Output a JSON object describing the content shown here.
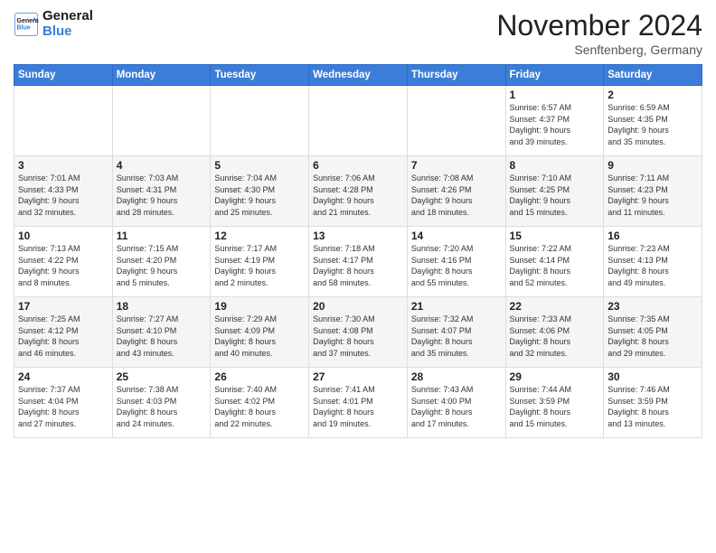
{
  "logo": {
    "line1": "General",
    "line2": "Blue"
  },
  "header": {
    "month": "November 2024",
    "location": "Senftenberg, Germany"
  },
  "weekdays": [
    "Sunday",
    "Monday",
    "Tuesday",
    "Wednesday",
    "Thursday",
    "Friday",
    "Saturday"
  ],
  "weeks": [
    [
      {
        "day": "",
        "info": ""
      },
      {
        "day": "",
        "info": ""
      },
      {
        "day": "",
        "info": ""
      },
      {
        "day": "",
        "info": ""
      },
      {
        "day": "",
        "info": ""
      },
      {
        "day": "1",
        "info": "Sunrise: 6:57 AM\nSunset: 4:37 PM\nDaylight: 9 hours\nand 39 minutes."
      },
      {
        "day": "2",
        "info": "Sunrise: 6:59 AM\nSunset: 4:35 PM\nDaylight: 9 hours\nand 35 minutes."
      }
    ],
    [
      {
        "day": "3",
        "info": "Sunrise: 7:01 AM\nSunset: 4:33 PM\nDaylight: 9 hours\nand 32 minutes."
      },
      {
        "day": "4",
        "info": "Sunrise: 7:03 AM\nSunset: 4:31 PM\nDaylight: 9 hours\nand 28 minutes."
      },
      {
        "day": "5",
        "info": "Sunrise: 7:04 AM\nSunset: 4:30 PM\nDaylight: 9 hours\nand 25 minutes."
      },
      {
        "day": "6",
        "info": "Sunrise: 7:06 AM\nSunset: 4:28 PM\nDaylight: 9 hours\nand 21 minutes."
      },
      {
        "day": "7",
        "info": "Sunrise: 7:08 AM\nSunset: 4:26 PM\nDaylight: 9 hours\nand 18 minutes."
      },
      {
        "day": "8",
        "info": "Sunrise: 7:10 AM\nSunset: 4:25 PM\nDaylight: 9 hours\nand 15 minutes."
      },
      {
        "day": "9",
        "info": "Sunrise: 7:11 AM\nSunset: 4:23 PM\nDaylight: 9 hours\nand 11 minutes."
      }
    ],
    [
      {
        "day": "10",
        "info": "Sunrise: 7:13 AM\nSunset: 4:22 PM\nDaylight: 9 hours\nand 8 minutes."
      },
      {
        "day": "11",
        "info": "Sunrise: 7:15 AM\nSunset: 4:20 PM\nDaylight: 9 hours\nand 5 minutes."
      },
      {
        "day": "12",
        "info": "Sunrise: 7:17 AM\nSunset: 4:19 PM\nDaylight: 9 hours\nand 2 minutes."
      },
      {
        "day": "13",
        "info": "Sunrise: 7:18 AM\nSunset: 4:17 PM\nDaylight: 8 hours\nand 58 minutes."
      },
      {
        "day": "14",
        "info": "Sunrise: 7:20 AM\nSunset: 4:16 PM\nDaylight: 8 hours\nand 55 minutes."
      },
      {
        "day": "15",
        "info": "Sunrise: 7:22 AM\nSunset: 4:14 PM\nDaylight: 8 hours\nand 52 minutes."
      },
      {
        "day": "16",
        "info": "Sunrise: 7:23 AM\nSunset: 4:13 PM\nDaylight: 8 hours\nand 49 minutes."
      }
    ],
    [
      {
        "day": "17",
        "info": "Sunrise: 7:25 AM\nSunset: 4:12 PM\nDaylight: 8 hours\nand 46 minutes."
      },
      {
        "day": "18",
        "info": "Sunrise: 7:27 AM\nSunset: 4:10 PM\nDaylight: 8 hours\nand 43 minutes."
      },
      {
        "day": "19",
        "info": "Sunrise: 7:29 AM\nSunset: 4:09 PM\nDaylight: 8 hours\nand 40 minutes."
      },
      {
        "day": "20",
        "info": "Sunrise: 7:30 AM\nSunset: 4:08 PM\nDaylight: 8 hours\nand 37 minutes."
      },
      {
        "day": "21",
        "info": "Sunrise: 7:32 AM\nSunset: 4:07 PM\nDaylight: 8 hours\nand 35 minutes."
      },
      {
        "day": "22",
        "info": "Sunrise: 7:33 AM\nSunset: 4:06 PM\nDaylight: 8 hours\nand 32 minutes."
      },
      {
        "day": "23",
        "info": "Sunrise: 7:35 AM\nSunset: 4:05 PM\nDaylight: 8 hours\nand 29 minutes."
      }
    ],
    [
      {
        "day": "24",
        "info": "Sunrise: 7:37 AM\nSunset: 4:04 PM\nDaylight: 8 hours\nand 27 minutes."
      },
      {
        "day": "25",
        "info": "Sunrise: 7:38 AM\nSunset: 4:03 PM\nDaylight: 8 hours\nand 24 minutes."
      },
      {
        "day": "26",
        "info": "Sunrise: 7:40 AM\nSunset: 4:02 PM\nDaylight: 8 hours\nand 22 minutes."
      },
      {
        "day": "27",
        "info": "Sunrise: 7:41 AM\nSunset: 4:01 PM\nDaylight: 8 hours\nand 19 minutes."
      },
      {
        "day": "28",
        "info": "Sunrise: 7:43 AM\nSunset: 4:00 PM\nDaylight: 8 hours\nand 17 minutes."
      },
      {
        "day": "29",
        "info": "Sunrise: 7:44 AM\nSunset: 3:59 PM\nDaylight: 8 hours\nand 15 minutes."
      },
      {
        "day": "30",
        "info": "Sunrise: 7:46 AM\nSunset: 3:59 PM\nDaylight: 8 hours\nand 13 minutes."
      }
    ]
  ]
}
